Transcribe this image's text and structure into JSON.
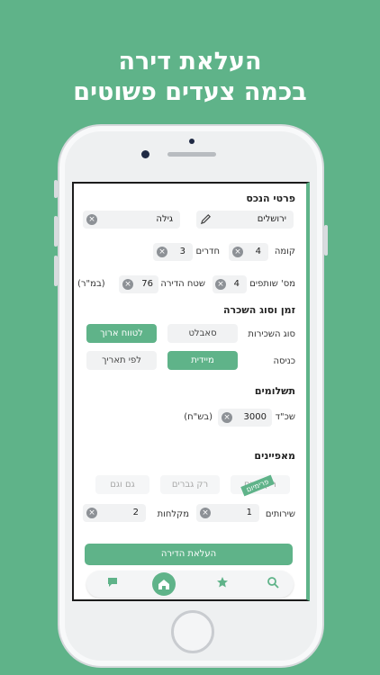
{
  "headline": {
    "line1": "העלאת דירה",
    "line2": "בכמה צעדים פשוטים"
  },
  "property": {
    "section_title": "פרטי הנכס",
    "city": "ירושלים",
    "neighborhood": "גילה",
    "floor_label": "קומה",
    "floor_value": "4",
    "rooms_label": "חדרים",
    "rooms_value": "3",
    "roommates_label": "מס' שותפים",
    "roommates_value": "4",
    "area_label": "שטח הדירה",
    "area_value": "76",
    "area_unit": "(במ\"ר)"
  },
  "rental": {
    "section_title": "זמן וסוג השכרה",
    "type_label": "סוג השכירות",
    "type_options": [
      "לטווח ארוך",
      "סאבלט"
    ],
    "type_selected": "לטווח ארוך",
    "entry_label": "כניסה",
    "entry_options": [
      "מיידית",
      "לפי תאריך"
    ],
    "entry_selected": "מיידית"
  },
  "payments": {
    "section_title": "תשלומים",
    "rent_label": "שכ\"ד",
    "rent_value": "3000",
    "rent_unit": "(בש\"ח)"
  },
  "features": {
    "section_title": "מאפיינים",
    "gender_options": [
      "רק נשים",
      "רק גברים",
      "גם וגם"
    ],
    "tag": "פרימיום",
    "toilets_label": "שירותים",
    "toilets_value": "1",
    "showers_label": "מקלחות",
    "showers_value": "2"
  },
  "actions": {
    "upload_label": "העלאת הדירה"
  },
  "nav": {
    "items": [
      "search-icon",
      "star-icon",
      "home-icon",
      "chat-icon"
    ]
  },
  "colors": {
    "brand": "#5fb389",
    "background": "#5fb389"
  }
}
